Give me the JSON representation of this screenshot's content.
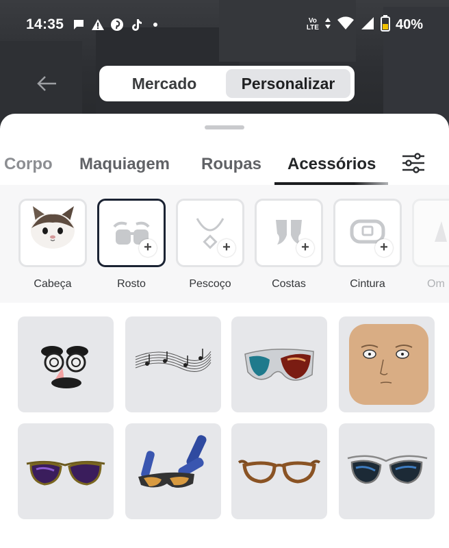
{
  "status_bar": {
    "time": "14:35",
    "network_label": "Vo\nLTE",
    "battery_percent": "40%",
    "notification_icons": [
      "chat-icon",
      "warning-icon",
      "pinterest-icon",
      "tiktok-icon",
      "dot-icon"
    ]
  },
  "top_nav": {
    "segments": [
      "Mercado",
      "Personalizar"
    ],
    "selected_segment": "Personalizar"
  },
  "tabs": {
    "items": [
      "Corpo",
      "Maquiagem",
      "Roupas",
      "Acessórios"
    ],
    "active": "Acessórios"
  },
  "categories": [
    {
      "label": "Cabeça",
      "icon": "cat-head-icon"
    },
    {
      "label": "Rosto",
      "icon": "glasses-icon"
    },
    {
      "label": "Pescoço",
      "icon": "necklace-icon"
    },
    {
      "label": "Costas",
      "icon": "wings-icon"
    },
    {
      "label": "Cintura",
      "icon": "belt-icon"
    },
    {
      "label": "Om",
      "icon": "shoulder-icon"
    }
  ],
  "selected_category": "Rosto",
  "items": [
    {
      "icon": "groucho-glasses-icon"
    },
    {
      "icon": "music-notes-icon"
    },
    {
      "icon": "red-blue-sunglasses-icon"
    },
    {
      "icon": "bald-face-icon"
    },
    {
      "icon": "purple-aviators-icon"
    },
    {
      "icon": "blaster-glasses-icon"
    },
    {
      "icon": "brown-glasses-icon"
    },
    {
      "icon": "blue-aviators-icon"
    }
  ],
  "colors": {
    "selected_border": "#1b2333",
    "tile_background": "#e6e7ea",
    "sheet_background": "#ffffff"
  }
}
